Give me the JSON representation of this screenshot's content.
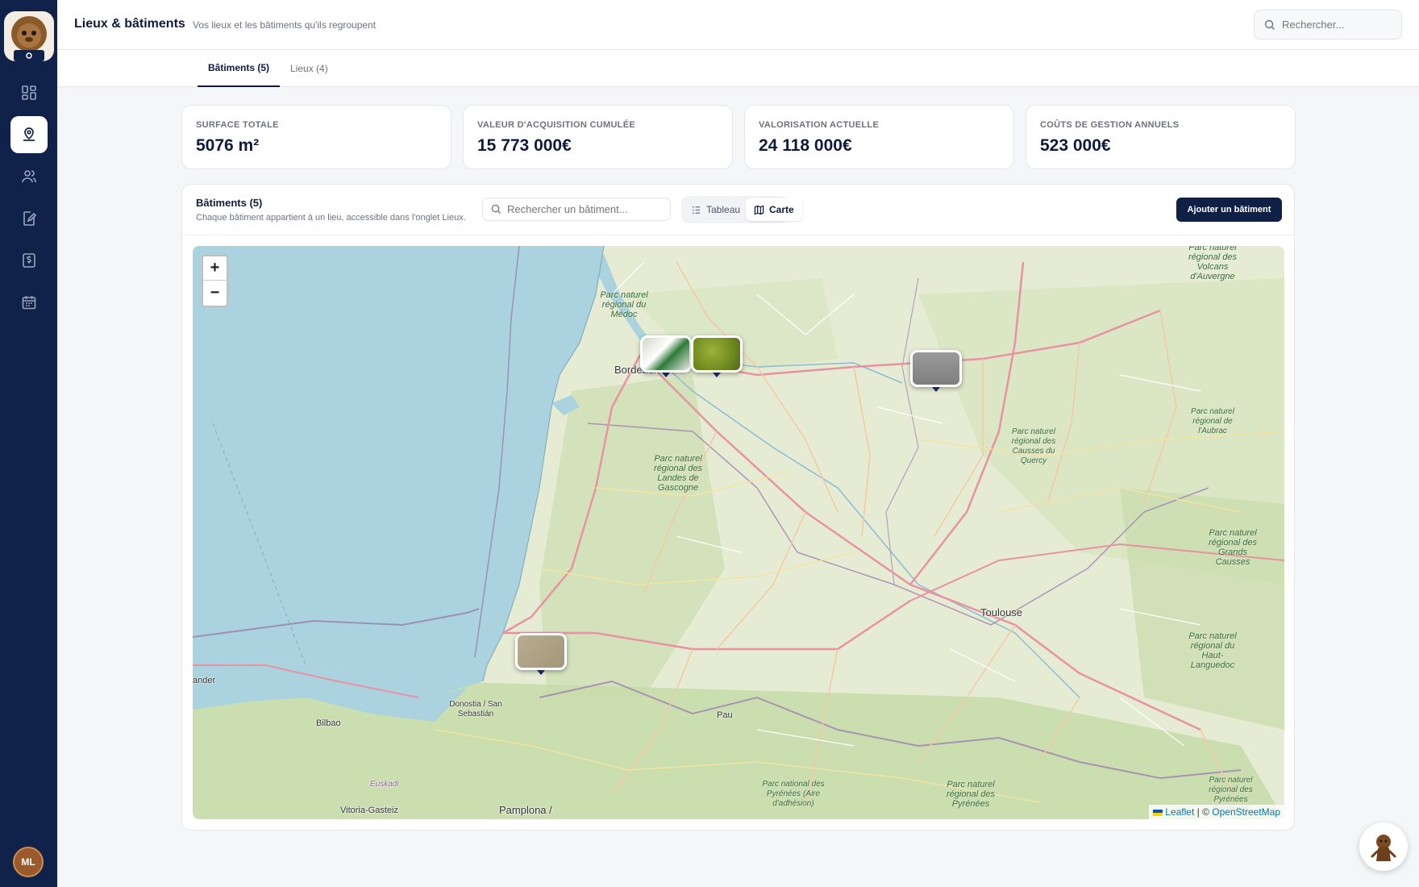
{
  "header": {
    "title": "Lieux & bâtiments",
    "subtitle": "Vos lieux et les bâtiments qu'ils regroupent",
    "search_placeholder": "Rechercher..."
  },
  "user": {
    "initials": "ML"
  },
  "tabs": [
    {
      "label": "Bâtiments (5)",
      "active": true
    },
    {
      "label": "Lieux (4)",
      "active": false
    }
  ],
  "kpis": [
    {
      "label": "SURFACE TOTALE",
      "value": "5076 m²"
    },
    {
      "label": "VALEUR D'ACQUISITION CUMULÉE",
      "value": "15 773 000€"
    },
    {
      "label": "VALORISATION ACTUELLE",
      "value": "24 118 000€"
    },
    {
      "label": "COÛTS DE GESTION ANNUELS",
      "value": "523 000€"
    }
  ],
  "buildings": {
    "title": "Bâtiments (5)",
    "subtitle": "Chaque bâtiment appartient à un lieu, accessible dans l'onglet Lieux.",
    "search_placeholder": "Rechercher un bâtiment...",
    "view_table": "Tableau",
    "view_map": "Carte",
    "active_view": "Carte",
    "add_label": "Ajouter un bâtiment"
  },
  "map": {
    "zoom_in": "+",
    "zoom_out": "−",
    "cities": [
      "Bordeaux",
      "Toulouse",
      "Donostia / San Sebastián",
      "Bilbao",
      "Pau",
      "Pamplona /",
      "Vitoria-Gasteiz",
      "Euskadi",
      "ander"
    ],
    "parks": [
      "Parc naturel régional du Médoc",
      "Parc naturel régional des Landes de Gascogne",
      "Parc naturel régional des Volcans d'Auvergne",
      "Parc naturel régional de l'Aubrac",
      "Parc naturel régional des Causses du Quercy",
      "Parc naturel régional des Grands Causses",
      "Parc naturel régional du Haut-Languedoc",
      "Parc national des Pyrénées (Aire d'adhésion)",
      "Parc naturel régional des Pyrénées",
      "Parc naturel régional des Pyrénées Catalanes"
    ],
    "attribution_leaflet": "Leaflet",
    "attribution_sep": " | © ",
    "attribution_osm": "OpenStreetMap"
  },
  "colors": {
    "sidebar": "#10224a",
    "primary": "#0f1f45",
    "sea": "#aad3df",
    "land": "#e8eedb"
  }
}
